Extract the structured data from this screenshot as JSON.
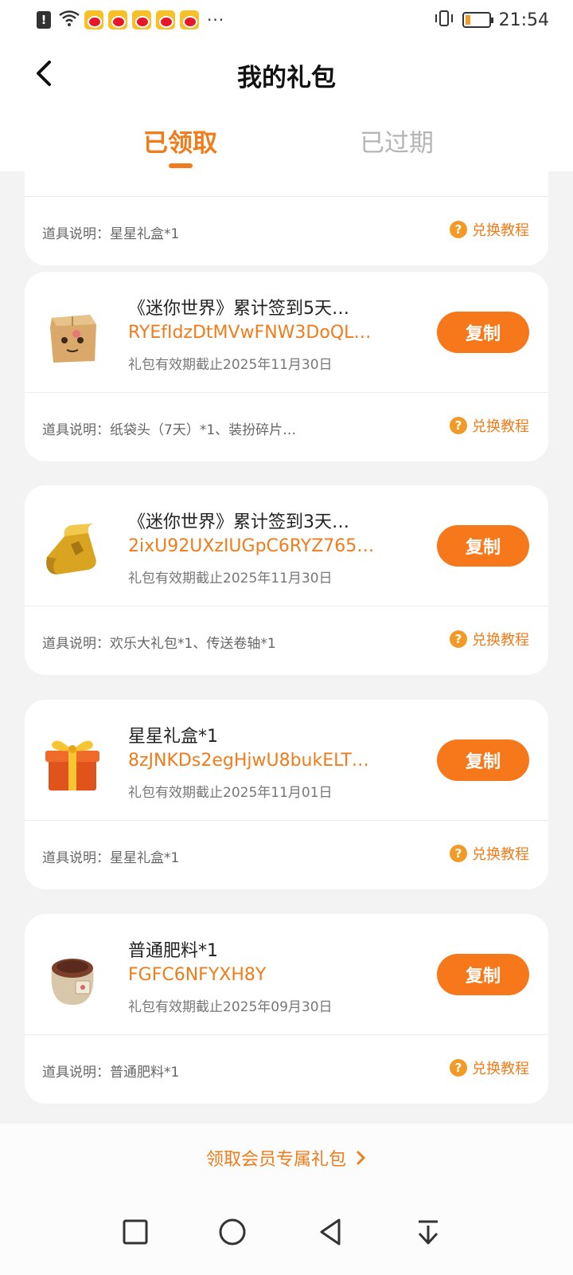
{
  "status_bar": {
    "time": "21:54",
    "alert": "!",
    "more": "···",
    "icons": [
      "alert-icon",
      "wifi-icon",
      "weibo-icon",
      "weibo-icon",
      "weibo-icon",
      "weibo-icon",
      "weibo-icon",
      "more-icon",
      "vibrate-icon",
      "battery-icon"
    ],
    "battery_level": 0.2
  },
  "header": {
    "title": "我的礼包",
    "tabs": [
      {
        "label": "已领取",
        "active": true
      },
      {
        "label": "已过期",
        "active": false
      }
    ]
  },
  "colors": {
    "accent": "#f07c1b",
    "button": "#f7781b",
    "background": "#f3f3f3"
  },
  "partial_card": {
    "description": "道具说明：星星礼盒*1",
    "tutorial_label": "兑换教程"
  },
  "cards": [
    {
      "icon": "paper-bag-head-icon",
      "name": "《迷你世界》累计签到5天…",
      "code": "RYEfIdzDtMVwFNW3DoQL…",
      "expiry": "礼包有效期截止2025年11月30日",
      "copy_label": "复制",
      "description": "道具说明：纸袋头（7天）*1、装扮碎片…",
      "tutorial_label": "兑换教程"
    },
    {
      "icon": "golden-scroll-icon",
      "name": "《迷你世界》累计签到3天…",
      "code": "2ixU92UXzIUGpC6RYZ765…",
      "expiry": "礼包有效期截止2025年11月30日",
      "copy_label": "复制",
      "description": "道具说明：欢乐大礼包*1、传送卷轴*1",
      "tutorial_label": "兑换教程"
    },
    {
      "icon": "gift-box-icon",
      "name": "星星礼盒*1",
      "code": "8zJNKDs2egHjwU8bukELT…",
      "expiry": "礼包有效期截止2025年11月01日",
      "copy_label": "复制",
      "description": "道具说明：星星礼盒*1",
      "tutorial_label": "兑换教程"
    },
    {
      "icon": "fertilizer-bag-icon",
      "name": "普通肥料*1",
      "code": "FGFC6NFYXH8Y",
      "expiry": "礼包有效期截止2025年09月30日",
      "copy_label": "复制",
      "description": "道具说明：普通肥料*1",
      "tutorial_label": "兑换教程"
    }
  ],
  "footer": {
    "member_link": "领取会员专属礼包"
  },
  "nav_bar": {
    "buttons": [
      "recent-apps-icon",
      "home-icon",
      "back-icon",
      "notification-pull-icon"
    ]
  }
}
